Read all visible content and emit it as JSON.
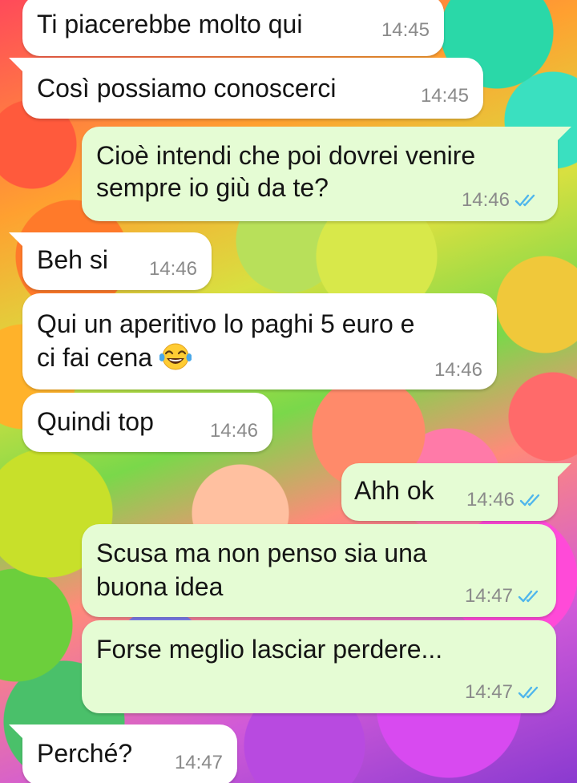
{
  "chat": {
    "messages": [
      {
        "type": "incoming",
        "text": "Ti piacerebbe molto qui",
        "time": "14:45"
      },
      {
        "type": "incoming",
        "text": "Così possiamo conoscerci",
        "time": "14:45"
      },
      {
        "type": "outgoing",
        "line1": "Cioè intendi che poi dovrei venire",
        "line2": "sempre io giù da te?",
        "time": "14:46",
        "status": "read"
      },
      {
        "type": "incoming",
        "text": "Beh si",
        "time": "14:46"
      },
      {
        "type": "incoming",
        "line1": "Qui un aperitivo lo paghi 5 euro e",
        "line2": "ci fai cena",
        "emoji": "laughing-tears-emoji",
        "time": "14:46"
      },
      {
        "type": "incoming",
        "text": "Quindi top",
        "time": "14:46"
      },
      {
        "type": "outgoing",
        "text": "Ahh ok",
        "time": "14:46",
        "status": "read"
      },
      {
        "type": "outgoing",
        "line1": "Scusa ma non penso sia una",
        "line2": "buona idea",
        "time": "14:47",
        "status": "read"
      },
      {
        "type": "outgoing",
        "text": "Forse meglio lasciar perdere...",
        "time": "14:47",
        "status": "read"
      },
      {
        "type": "incoming",
        "text": "Perché?",
        "time": "14:47"
      }
    ]
  },
  "colors": {
    "incoming_bubble": "#ffffff",
    "outgoing_bubble": "#e5fcd4",
    "read_ticks": "#4fb6ec",
    "timestamp": "#8a8a8a"
  },
  "icons": {
    "read_status": "double-check-icon",
    "emoji": "face-with-tears-of-joy"
  }
}
